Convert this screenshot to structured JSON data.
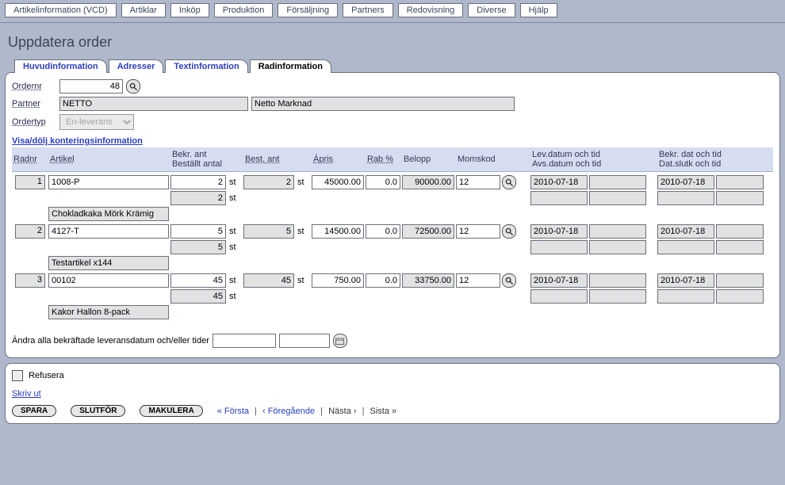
{
  "menu": {
    "items": [
      "Artikelinformation (VCD)",
      "Artiklar",
      "Inköp",
      "Produktion",
      "Försäljning",
      "Partners",
      "Redovisning",
      "Diverse",
      "Hjälp"
    ]
  },
  "page": {
    "title": "Uppdatera order"
  },
  "tabs": {
    "items": [
      "Huvudinformation",
      "Adresser",
      "Textinformation",
      "Radinformation"
    ],
    "active": 3
  },
  "header": {
    "ordernr_label": "Ordernr",
    "ordernr_value": "48",
    "partner_label": "Partner",
    "partner_code": "NETTO",
    "partner_name": "Netto Marknad",
    "ordertyp_label": "Ordertyp",
    "ordertyp_value": "En-leverans"
  },
  "grid": {
    "toggle_label": "Visa/dölj konteringsinformation",
    "columns": {
      "radnr": "Radnr",
      "artikel": "Artikel",
      "bekr_bestallt": "Bekr. ant\nBeställt antal",
      "best_ant": "Best. ant",
      "apris": "Ápris",
      "rab": "Rab %",
      "belopp": "Belopp",
      "momskod": "Momskod",
      "lev_avs": "Lev.datum och tid\nAvs.datum och tid",
      "bekr_dat": "Bekr. dat och tid\nDat.slutk och tid"
    },
    "rows": [
      {
        "nr": "1",
        "artikel_code": "1008-P",
        "artikel_name": "Chokladkaka Mörk Krämig",
        "bekr_ant": "2",
        "bestallt_antal": "2",
        "unit": "st",
        "best_ant": "2",
        "apris": "45000.00",
        "rab": "0.0",
        "belopp": "90000.00",
        "momskod": "12",
        "lev_datum": "2010-07-18",
        "lev_tid": "",
        "avs_datum": "",
        "avs_tid": "",
        "bekr_datum": "2010-07-18",
        "bekr_tid": "",
        "slutk_datum": "",
        "slutk_tid": ""
      },
      {
        "nr": "2",
        "artikel_code": "4127-T",
        "artikel_name": "Testartikel x144",
        "bekr_ant": "5",
        "bestallt_antal": "5",
        "unit": "st",
        "best_ant": "5",
        "apris": "14500.00",
        "rab": "0.0",
        "belopp": "72500.00",
        "momskod": "12",
        "lev_datum": "2010-07-18",
        "lev_tid": "",
        "avs_datum": "",
        "avs_tid": "",
        "bekr_datum": "2010-07-18",
        "bekr_tid": "",
        "slutk_datum": "",
        "slutk_tid": ""
      },
      {
        "nr": "3",
        "artikel_code": "00102",
        "artikel_name": "Kakor Hallon 8-pack",
        "bekr_ant": "45",
        "bestallt_antal": "45",
        "unit": "st",
        "best_ant": "45",
        "apris": "750.00",
        "rab": "0.0",
        "belopp": "33750.00",
        "momskod": "12",
        "lev_datum": "2010-07-18",
        "lev_tid": "",
        "avs_datum": "",
        "avs_tid": "",
        "bekr_datum": "2010-07-18",
        "bekr_tid": "",
        "slutk_datum": "",
        "slutk_tid": ""
      }
    ],
    "bulk_label": "Ändra alla bekräftade leveransdatum och/eller tider",
    "bulk_date": "",
    "bulk_time": ""
  },
  "footer": {
    "refusera_label": "Refusera",
    "skriv_ut_label": "Skriv ut",
    "buttons": {
      "spara": "SPARA",
      "slutfor": "SLUTFÖR",
      "makulera": "MAKULERA"
    },
    "pager": {
      "first": "« Första",
      "prev": "‹ Föregående",
      "next": "Nästa ›",
      "last": "Sista »"
    }
  }
}
